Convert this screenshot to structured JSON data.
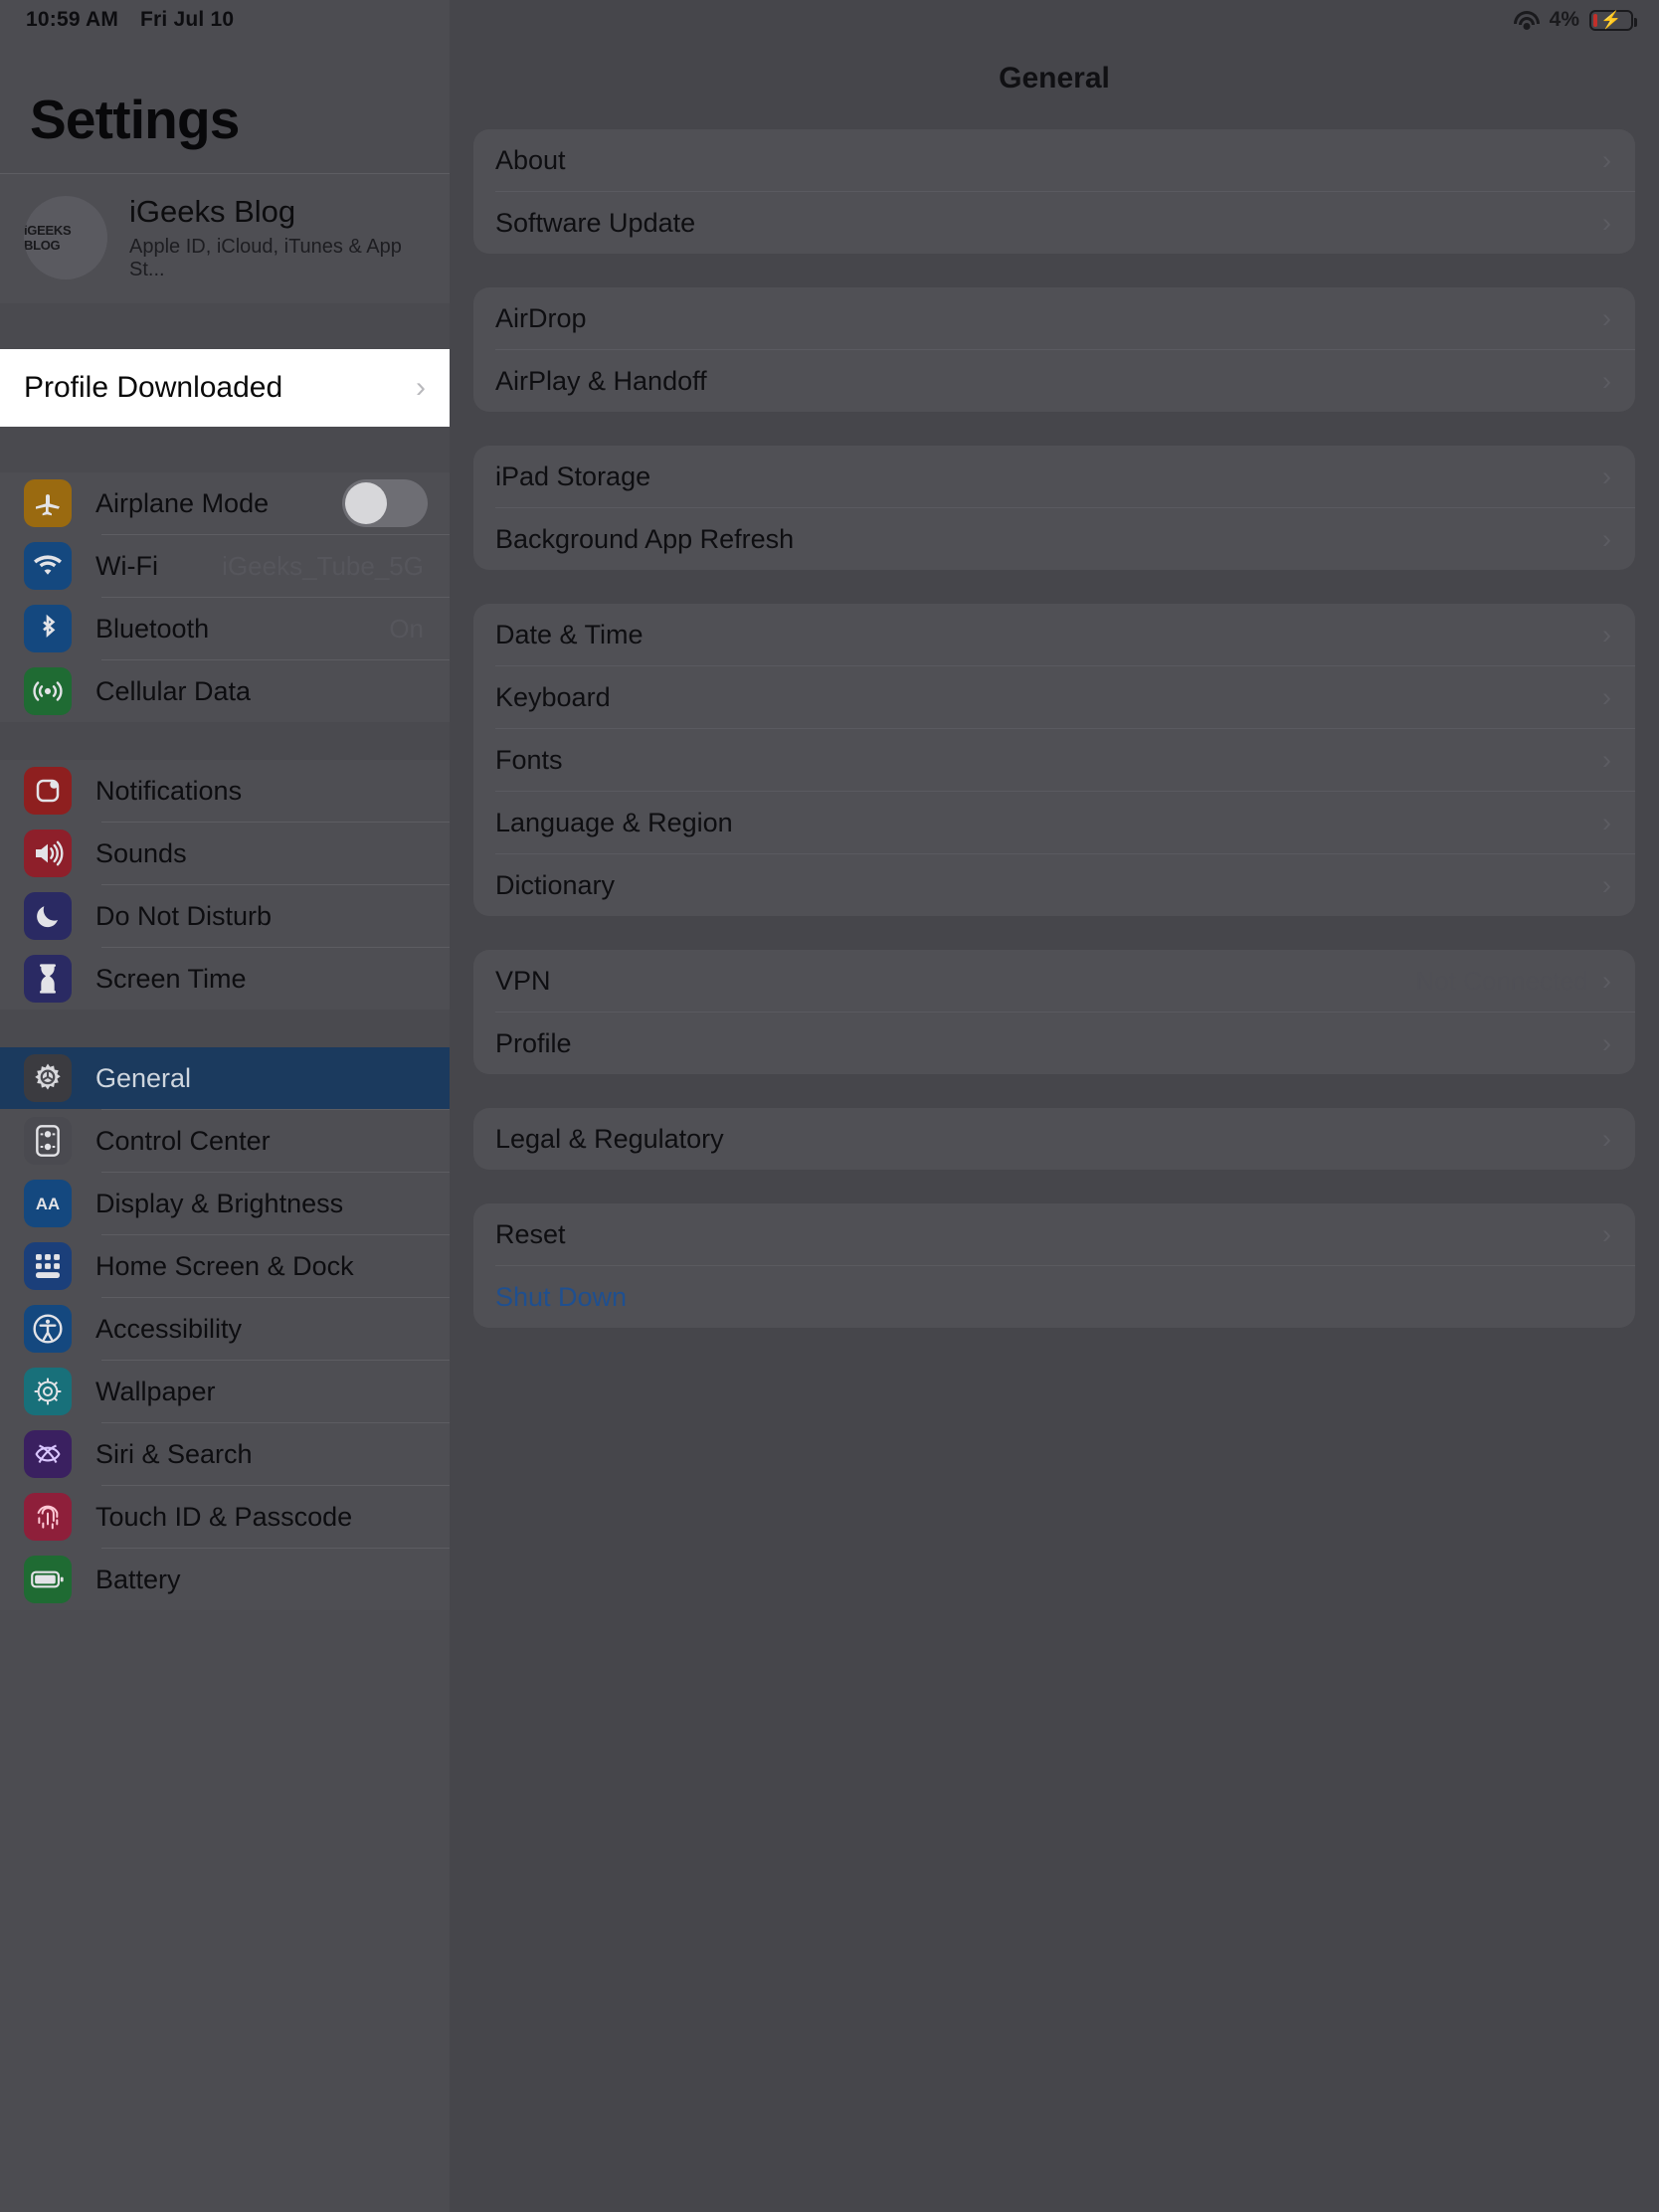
{
  "status_bar": {
    "time": "10:59 AM",
    "date": "Fri Jul 10",
    "battery_percent": "4%",
    "wifi_icon": "wifi-icon",
    "battery_icon": "battery-charging-icon"
  },
  "sidebar": {
    "title": "Settings",
    "account": {
      "avatar_text": "iGEEKS BLOG",
      "name": "iGeeks Blog",
      "subtitle": "Apple ID, iCloud, iTunes & App St..."
    },
    "spotlight_row": {
      "label": "Profile Downloaded",
      "chevron": "›"
    },
    "groups": [
      {
        "items": [
          {
            "label": "Airplane Mode",
            "icon": "airplane-icon",
            "icon_bg": "#9a6a10",
            "control": "toggle",
            "toggle_on": false
          },
          {
            "label": "Wi-Fi",
            "icon": "wifi-icon",
            "icon_bg": "#14487f",
            "value": "iGeeks_Tube_5G"
          },
          {
            "label": "Bluetooth",
            "icon": "bluetooth-icon",
            "icon_bg": "#14487f",
            "value": "On"
          },
          {
            "label": "Cellular Data",
            "icon": "cellular-icon",
            "icon_bg": "#1f6b33"
          }
        ]
      },
      {
        "items": [
          {
            "label": "Notifications",
            "icon": "notifications-icon",
            "icon_bg": "#8e1f1f"
          },
          {
            "label": "Sounds",
            "icon": "sounds-icon",
            "icon_bg": "#8e1f2a"
          },
          {
            "label": "Do Not Disturb",
            "icon": "moon-icon",
            "icon_bg": "#2a2a63"
          },
          {
            "label": "Screen Time",
            "icon": "hourglass-icon",
            "icon_bg": "#2a2a63"
          }
        ]
      },
      {
        "items": [
          {
            "label": "General",
            "icon": "gear-icon",
            "icon_bg": "#3b3b40",
            "selected": true
          },
          {
            "label": "Control Center",
            "icon": "control-center-icon",
            "icon_bg": "#4a4a50"
          },
          {
            "label": "Display & Brightness",
            "icon": "display-icon",
            "icon_bg": "#14487f"
          },
          {
            "label": "Home Screen & Dock",
            "icon": "home-screen-icon",
            "icon_bg": "#1b3f7a"
          },
          {
            "label": "Accessibility",
            "icon": "accessibility-icon",
            "icon_bg": "#14487f"
          },
          {
            "label": "Wallpaper",
            "icon": "wallpaper-icon",
            "icon_bg": "#18707a"
          },
          {
            "label": "Siri & Search",
            "icon": "siri-icon",
            "icon_bg": "#3a2060"
          },
          {
            "label": "Touch ID & Passcode",
            "icon": "touch-id-icon",
            "icon_bg": "#8e1f3a"
          },
          {
            "label": "Battery",
            "icon": "battery-icon",
            "icon_bg": "#1f6b33"
          }
        ]
      }
    ]
  },
  "main": {
    "title": "General",
    "chevron": "›",
    "cards": [
      {
        "rows": [
          {
            "label": "About",
            "chevron": true
          },
          {
            "label": "Software Update",
            "chevron": true
          }
        ]
      },
      {
        "rows": [
          {
            "label": "AirDrop",
            "chevron": true
          },
          {
            "label": "AirPlay & Handoff",
            "chevron": true
          }
        ]
      },
      {
        "rows": [
          {
            "label": "iPad Storage",
            "chevron": true
          },
          {
            "label": "Background App Refresh",
            "chevron": true
          }
        ]
      },
      {
        "rows": [
          {
            "label": "Date & Time",
            "chevron": true
          },
          {
            "label": "Keyboard",
            "chevron": true
          },
          {
            "label": "Fonts",
            "chevron": true
          },
          {
            "label": "Language & Region",
            "chevron": true
          },
          {
            "label": "Dictionary",
            "chevron": true
          }
        ]
      },
      {
        "rows": [
          {
            "label": "VPN",
            "value": "Not Connected",
            "chevron": true
          },
          {
            "label": "Profile",
            "chevron": true
          }
        ]
      },
      {
        "rows": [
          {
            "label": "Legal & Regulatory",
            "chevron": true
          }
        ]
      },
      {
        "rows": [
          {
            "label": "Reset",
            "chevron": true
          },
          {
            "label": "Shut Down",
            "link": true
          }
        ]
      }
    ]
  },
  "colors": {
    "dim_bg": "#4a4a4f",
    "sidebar_bg": "#4c4c51",
    "selected_row": "#1b3a5e",
    "spotlight_bg": "#ffffff",
    "link_blue": "#1f4f8f"
  }
}
